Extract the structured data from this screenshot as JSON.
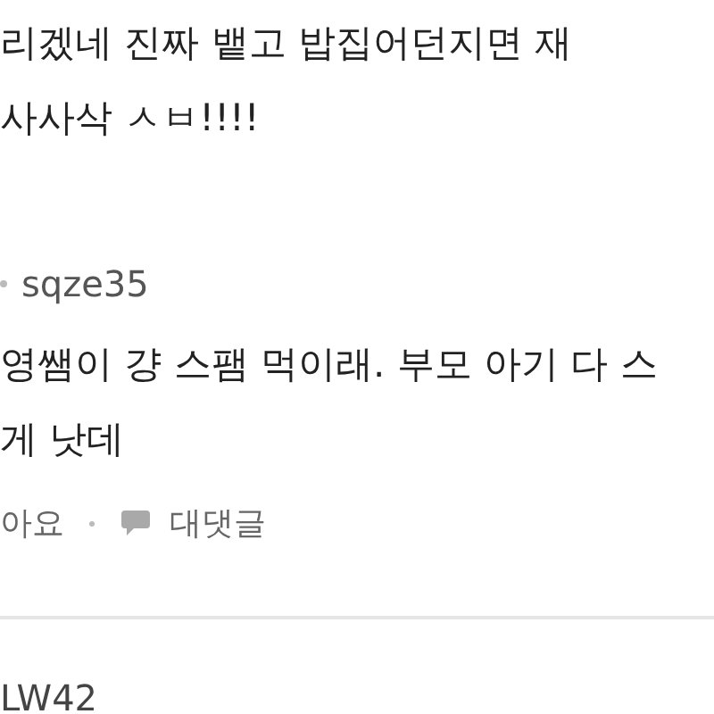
{
  "comments": [
    {
      "lines": [
        "리겠네 진짜 뱉고 밥집어던지면 재",
        "사사삭 ㅅㅂ!!!!"
      ]
    },
    {
      "author": "sqze35",
      "lines": [
        "영쌤이 걍 스팸 먹이래. 부모 아기 다 스",
        "게 낫데"
      ],
      "actions": {
        "like": "아요",
        "reply": "대댓글"
      }
    },
    {
      "author": "LW42"
    }
  ]
}
